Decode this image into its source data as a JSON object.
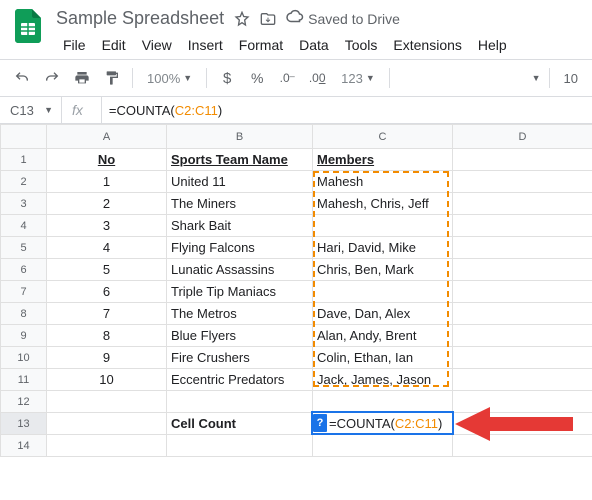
{
  "doc": {
    "title": "Sample Spreadsheet",
    "saved": "Saved to Drive"
  },
  "menu": [
    "File",
    "Edit",
    "View",
    "Insert",
    "Format",
    "Data",
    "Tools",
    "Extensions",
    "Help"
  ],
  "toolbar": {
    "zoom": "100%",
    "numfmt": "123",
    "fontsize": "10"
  },
  "namebox": "C13",
  "fx": {
    "fn": "=COUNTA",
    "open": "(",
    "range": "C2:C11",
    "close": ")"
  },
  "cols": [
    "A",
    "B",
    "C",
    "D"
  ],
  "rows": [
    {
      "n": 1,
      "a": "No",
      "b": "Sports Team Name",
      "c": "Members",
      "header": true
    },
    {
      "n": 2,
      "a": "1",
      "b": "United 11",
      "c": "Mahesh"
    },
    {
      "n": 3,
      "a": "2",
      "b": "The Miners",
      "c": "Mahesh, Chris, Jeff"
    },
    {
      "n": 4,
      "a": "3",
      "b": "Shark Bait",
      "c": ""
    },
    {
      "n": 5,
      "a": "4",
      "b": "Flying Falcons",
      "c": "Hari, David, Mike"
    },
    {
      "n": 6,
      "a": "5",
      "b": "Lunatic Assassins",
      "c": "Chris, Ben, Mark"
    },
    {
      "n": 7,
      "a": "6",
      "b": "Triple Tip Maniacs",
      "c": ""
    },
    {
      "n": 8,
      "a": "7",
      "b": "The Metros",
      "c": "Dave, Dan, Alex"
    },
    {
      "n": 9,
      "a": "8",
      "b": "Blue Flyers",
      "c": "Alan, Andy, Brent"
    },
    {
      "n": 10,
      "a": "9",
      "b": "Fire Crushers",
      "c": "Colin, Ethan, Ian"
    },
    {
      "n": 11,
      "a": "10",
      "b": "Eccentric Predators",
      "c": "Jack, James, Jason"
    },
    {
      "n": 12,
      "a": "",
      "b": "",
      "c": ""
    },
    {
      "n": 13,
      "a": "",
      "b": "Cell Count",
      "c": "",
      "formula": true,
      "bBold": true,
      "active": true
    },
    {
      "n": 14,
      "a": "",
      "b": "",
      "c": ""
    }
  ],
  "hint": "?"
}
